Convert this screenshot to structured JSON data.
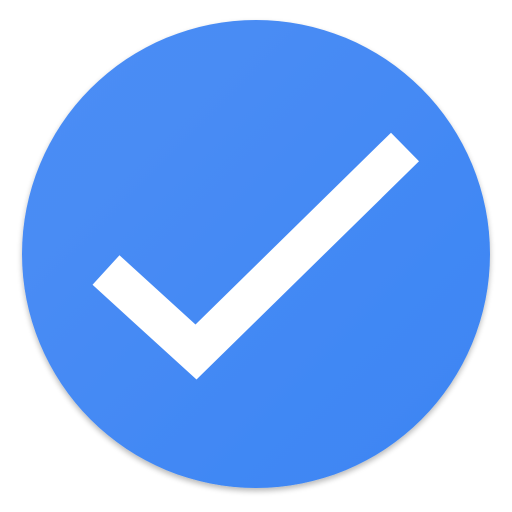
{
  "icon": {
    "name": "checkmark-icon",
    "shape": "circle",
    "colors": {
      "circle_start": "#4d8ef5",
      "circle_end": "#3c85f3",
      "checkmark": "#ffffff",
      "background": "#ffffff"
    }
  }
}
